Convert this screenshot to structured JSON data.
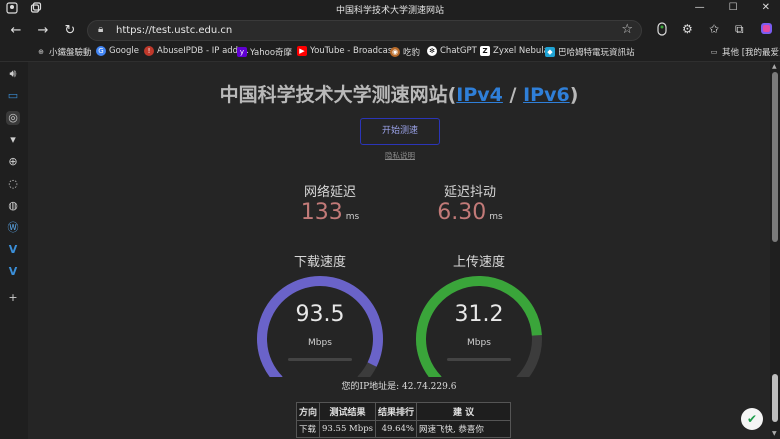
{
  "window": {
    "title": "中国科学技术大学测速网站",
    "minimize": "—",
    "maximize": "☐",
    "close": "✕"
  },
  "nav": {
    "url": "https://test.ustc.edu.cn"
  },
  "bookmarks": [
    {
      "label": "小鐵盤驗動",
      "icon": "globe-icon",
      "color": "#444444"
    },
    {
      "label": "Google",
      "icon": "google-icon",
      "color": "#4285f4"
    },
    {
      "label": "AbuseIPDB - IP addr...",
      "icon": "abuseipdb-icon",
      "color": "#c0392b"
    },
    {
      "label": "Yahoo奇摩",
      "icon": "yahoo-icon",
      "color": "#6001d2"
    },
    {
      "label": "YouTube - Broadcas...",
      "icon": "youtube-icon",
      "color": "#ff0000"
    },
    {
      "label": "吃豹",
      "icon": "leopard-icon",
      "color": "#b86b2a"
    },
    {
      "label": "ChatGPT",
      "icon": "chatgpt-icon",
      "color": "#ffffff"
    },
    {
      "label": "Zyxel Nebula",
      "icon": "zyxel-icon",
      "color": "#ffffff"
    },
    {
      "label": "巴哈姆特電玩資訊站",
      "icon": "bahamut-icon",
      "color": "#1fa3d4"
    }
  ],
  "bookmarks_other": "其他 [我的最爱]",
  "page": {
    "title_main": "中国科学技术大学测速网站(",
    "ipv4": "IPv4",
    "separator": " / ",
    "ipv6": "IPv6",
    "title_end": ")",
    "start_button": "开始测速",
    "privacy": "隐私说明",
    "latency_label": "网络延迟",
    "latency_value": "133",
    "latency_unit": "ms",
    "jitter_label": "延迟抖动",
    "jitter_value": "6.30",
    "jitter_unit": "ms",
    "download_label": "下载速度",
    "download_value": "93.5",
    "download_unit": "Mbps",
    "download_fraction": 0.93,
    "download_color": "#6a63c9",
    "upload_label": "上传速度",
    "upload_value": "31.2",
    "upload_unit": "Mbps",
    "upload_fraction": 0.82,
    "upload_color": "#3aa53a",
    "ip_line": "您的IP地址是: 42.74.229.6"
  },
  "table": {
    "headers": [
      "方向",
      "测试结果",
      "结果排行",
      "建 议"
    ],
    "rows": [
      [
        "下载",
        "93.55 Mbps",
        "49.64%",
        "网速飞快, 恭喜你"
      ]
    ]
  }
}
